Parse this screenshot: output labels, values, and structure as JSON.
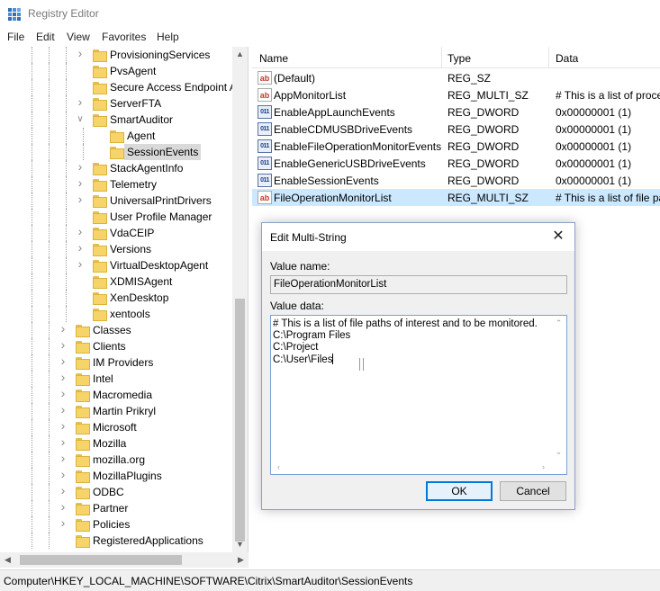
{
  "window": {
    "title": "Registry Editor",
    "menu": [
      "File",
      "Edit",
      "View",
      "Favorites",
      "Help"
    ]
  },
  "tree": {
    "items": [
      {
        "label": "ProvisioningServices",
        "level": 2,
        "chevron": "right"
      },
      {
        "label": "PvsAgent",
        "level": 2,
        "chevron": "none"
      },
      {
        "label": "Secure Access Endpoint A",
        "level": 2,
        "chevron": "none"
      },
      {
        "label": "ServerFTA",
        "level": 2,
        "chevron": "right"
      },
      {
        "label": "SmartAuditor",
        "level": 2,
        "chevron": "down"
      },
      {
        "label": "Agent",
        "level": 3,
        "chevron": "none"
      },
      {
        "label": "SessionEvents",
        "level": 3,
        "chevron": "none",
        "selected": true
      },
      {
        "label": "StackAgentInfo",
        "level": 2,
        "chevron": "right"
      },
      {
        "label": "Telemetry",
        "level": 2,
        "chevron": "right"
      },
      {
        "label": "UniversalPrintDrivers",
        "level": 2,
        "chevron": "right"
      },
      {
        "label": "User Profile Manager",
        "level": 2,
        "chevron": "none"
      },
      {
        "label": "VdaCEIP",
        "level": 2,
        "chevron": "right"
      },
      {
        "label": "Versions",
        "level": 2,
        "chevron": "right"
      },
      {
        "label": "VirtualDesktopAgent",
        "level": 2,
        "chevron": "right"
      },
      {
        "label": "XDMISAgent",
        "level": 2,
        "chevron": "none"
      },
      {
        "label": "XenDesktop",
        "level": 2,
        "chevron": "none"
      },
      {
        "label": "xentools",
        "level": 2,
        "chevron": "none"
      },
      {
        "label": "Classes",
        "level": 1,
        "chevron": "right"
      },
      {
        "label": "Clients",
        "level": 1,
        "chevron": "right"
      },
      {
        "label": "IM Providers",
        "level": 1,
        "chevron": "right"
      },
      {
        "label": "Intel",
        "level": 1,
        "chevron": "right"
      },
      {
        "label": "Macromedia",
        "level": 1,
        "chevron": "right"
      },
      {
        "label": "Martin Prikryl",
        "level": 1,
        "chevron": "right"
      },
      {
        "label": "Microsoft",
        "level": 1,
        "chevron": "right"
      },
      {
        "label": "Mozilla",
        "level": 1,
        "chevron": "right"
      },
      {
        "label": "mozilla.org",
        "level": 1,
        "chevron": "right"
      },
      {
        "label": "MozillaPlugins",
        "level": 1,
        "chevron": "right"
      },
      {
        "label": "ODBC",
        "level": 1,
        "chevron": "right"
      },
      {
        "label": "Partner",
        "level": 1,
        "chevron": "right"
      },
      {
        "label": "Policies",
        "level": 1,
        "chevron": "right"
      },
      {
        "label": "RegisteredApplications",
        "level": 1,
        "chevron": "none"
      }
    ]
  },
  "list": {
    "columns": {
      "name": "Name",
      "type": "Type",
      "data": "Data"
    },
    "rows": [
      {
        "name": "(Default)",
        "type": "REG_SZ",
        "data": "",
        "icon": "sz"
      },
      {
        "name": "AppMonitorList",
        "type": "REG_MULTI_SZ",
        "data": "# This is a list of proce",
        "icon": "sz"
      },
      {
        "name": "EnableAppLaunchEvents",
        "type": "REG_DWORD",
        "data": "0x00000001 (1)",
        "icon": "bin"
      },
      {
        "name": "EnableCDMUSBDriveEvents",
        "type": "REG_DWORD",
        "data": "0x00000001 (1)",
        "icon": "bin"
      },
      {
        "name": "EnableFileOperationMonitorEvents",
        "type": "REG_DWORD",
        "data": "0x00000001 (1)",
        "icon": "bin"
      },
      {
        "name": "EnableGenericUSBDriveEvents",
        "type": "REG_DWORD",
        "data": "0x00000001 (1)",
        "icon": "bin"
      },
      {
        "name": "EnableSessionEvents",
        "type": "REG_DWORD",
        "data": "0x00000001 (1)",
        "icon": "bin"
      },
      {
        "name": "FileOperationMonitorList",
        "type": "REG_MULTI_SZ",
        "data": "# This is a list of file pa",
        "icon": "sz",
        "selected": true
      }
    ]
  },
  "icons": {
    "sz": "ab",
    "bin": "011"
  },
  "dialog": {
    "title": "Edit Multi-String",
    "value_name_label": "Value name:",
    "value_name": "FileOperationMonitorList",
    "value_data_label": "Value data:",
    "value_data_lines": [
      "# This is a list of file paths of interest and to be monitored.",
      "C:\\Program Files",
      "C:\\Project",
      "C:\\User\\Files"
    ],
    "ok_label": "OK",
    "cancel_label": "Cancel"
  },
  "status": {
    "path": "Computer\\HKEY_LOCAL_MACHINE\\SOFTWARE\\Citrix\\SmartAuditor\\SessionEvents"
  }
}
